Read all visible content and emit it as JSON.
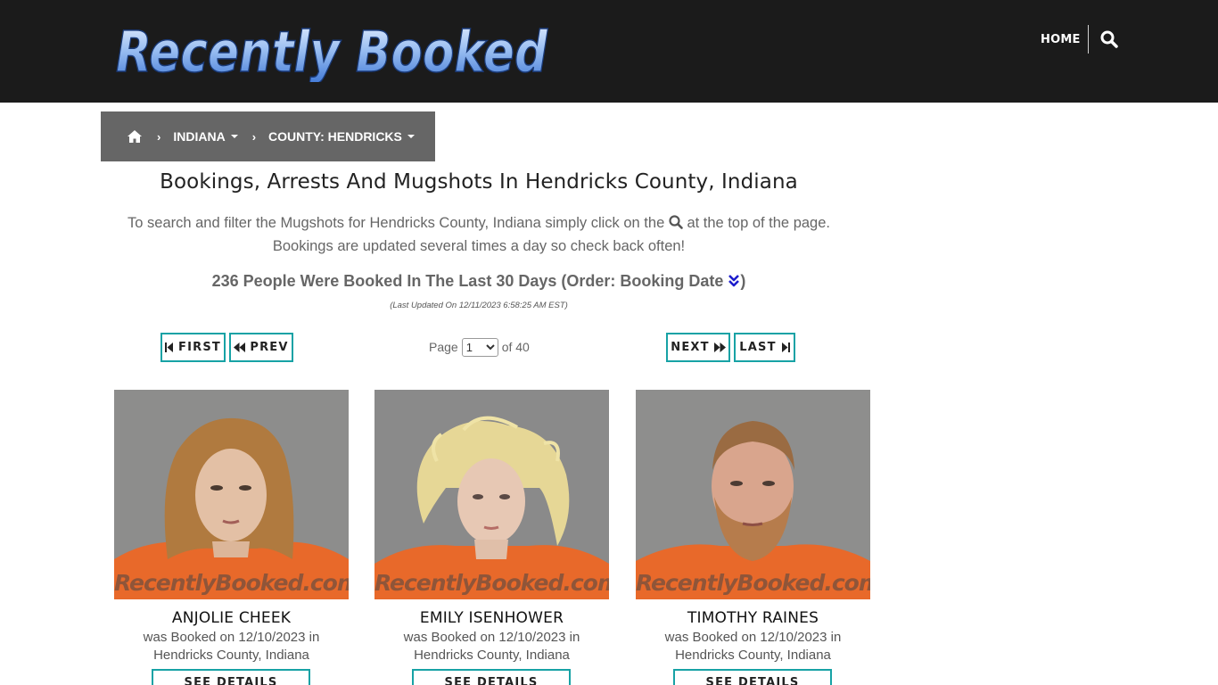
{
  "header": {
    "logo_text": "Recently Booked",
    "nav_home": "HOME",
    "search_icon": "search-icon"
  },
  "breadcrumb": {
    "home_icon": "home-icon",
    "items": [
      {
        "label": "INDIANA"
      },
      {
        "label": "COUNTY: HENDRICKS"
      }
    ]
  },
  "main": {
    "title": "Bookings, Arrests And Mugshots In Hendricks County, Indiana",
    "intro_before_icon": "To search and filter the Mugshots for Hendricks County, Indiana simply click on the",
    "intro_after_icon": "at the top of the page.",
    "intro_line2": "Bookings are updated several times a day so check back often!",
    "count_text": "236 People Were Booked In The Last 30 Days (Order: Booking Date",
    "count_close": ")",
    "updated_text": "(Last Updated On 12/11/2023 6:58:25 AM EST)"
  },
  "pager": {
    "first": "FIRST",
    "prev": "PREV",
    "next": "NEXT",
    "last": "LAST",
    "page_label": "Page",
    "current_page": "1",
    "of_label": "of 40"
  },
  "cards": [
    {
      "name": "ANJOLIE CHEEK",
      "booked_line": "was Booked on 12/10/2023 in",
      "location": "Hendricks County, Indiana",
      "button": "SEE DETAILS",
      "watermark": "RecentlyBooked.com"
    },
    {
      "name": "EMILY ISENHOWER",
      "booked_line": "was Booked on 12/10/2023 in",
      "location": "Hendricks County, Indiana",
      "button": "SEE DETAILS",
      "watermark": "RecentlyBooked.com"
    },
    {
      "name": "TIMOTHY RAINES",
      "booked_line": "was Booked on 12/10/2023 in",
      "location": "Hendricks County, Indiana",
      "button": "SEE DETAILS",
      "watermark": "RecentlyBooked.com"
    }
  ],
  "colors": {
    "header_bg": "#1b1b1b",
    "breadcrumb_bg": "#666666",
    "accent_teal": "#17a2a5",
    "logo_blue": "#5b8fdc",
    "inmate_orange": "#e8692a"
  }
}
